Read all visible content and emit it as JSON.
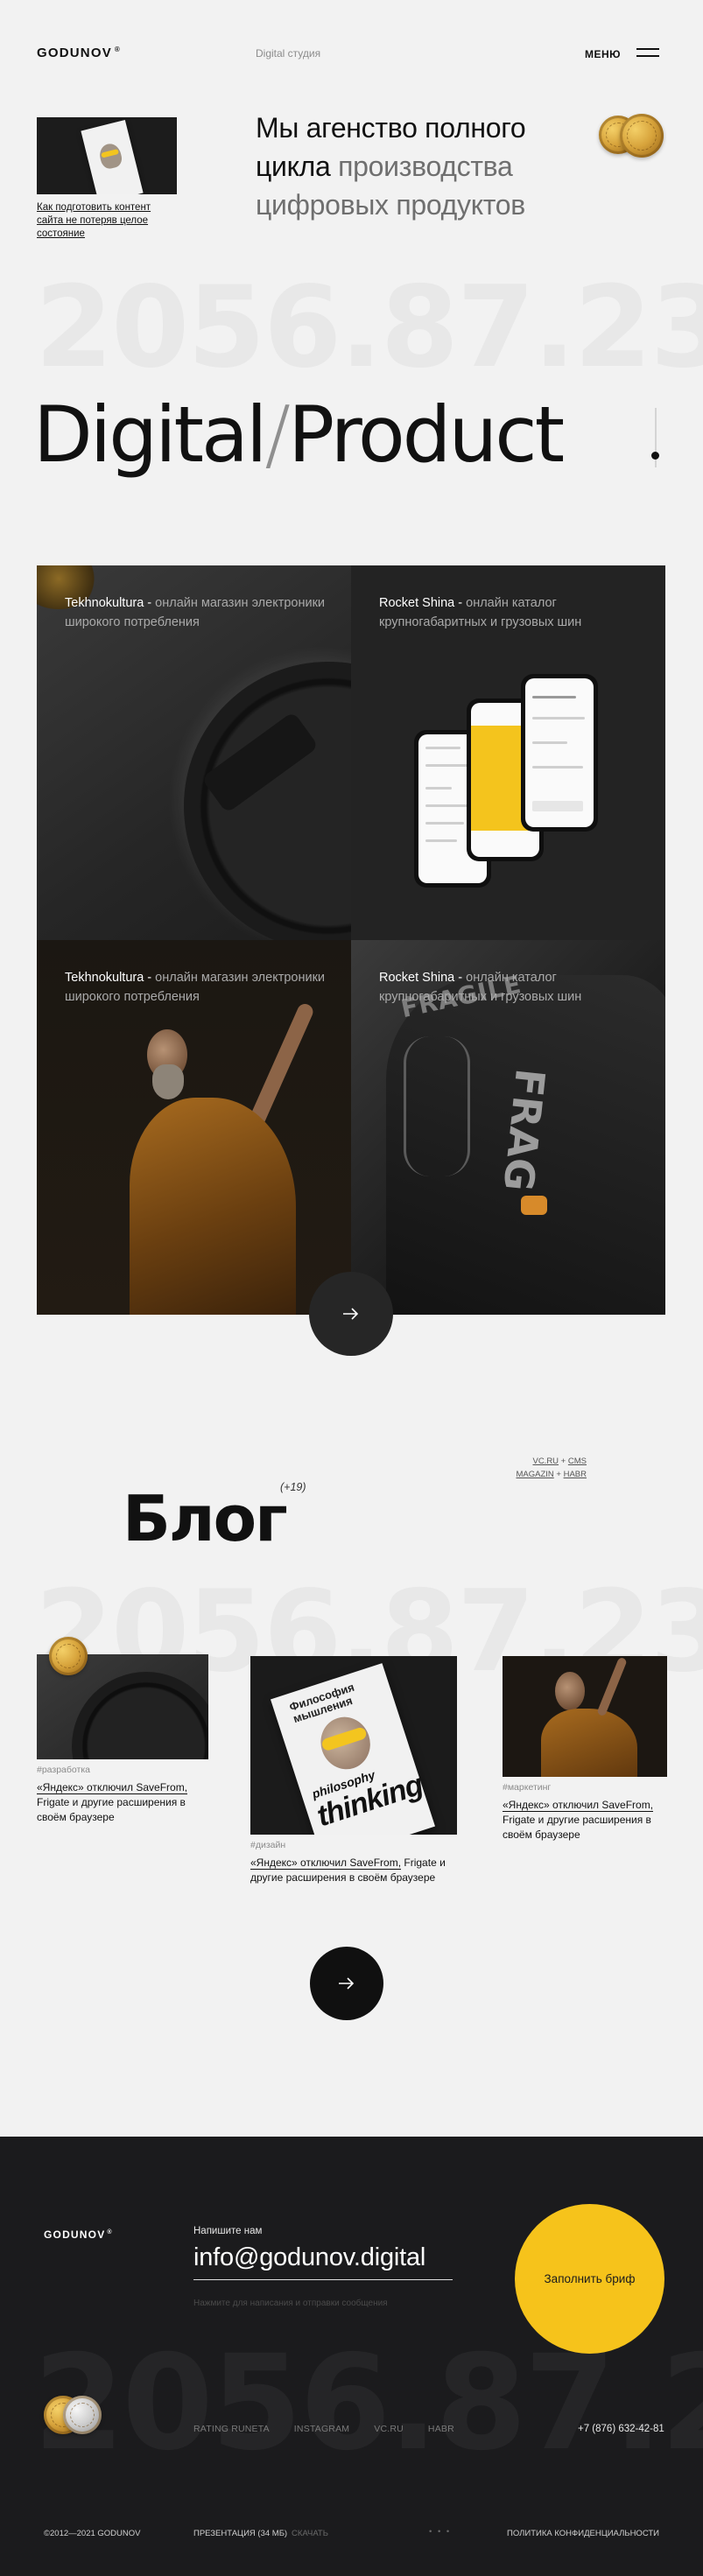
{
  "header": {
    "logo": "GODUNOV",
    "logo_mark": "®",
    "tagline": "Digital студия",
    "menu_label": "МЕНЮ"
  },
  "intro": {
    "card_link": "Как подготовить контент сайта не потеряв целое состояние",
    "headline_dark": "Мы агенство полного цикла",
    "headline_muted": "производства цифровых продуктов"
  },
  "decor_number": "2056.87.23",
  "hero": {
    "word_left": "Digital",
    "slash": "/",
    "word_right": "Product"
  },
  "projects": [
    {
      "name": "Tekhnokultura",
      "desc": "онлайн магазин электроники широкого потребления"
    },
    {
      "name": "Rocket Shina",
      "desc": "онлайн каталог крупногабаритных и грузовых шин"
    },
    {
      "name": "Tekhnokultura",
      "desc": "онлайн магазин электроники широкого потребления"
    },
    {
      "name": "Rocket Shina",
      "desc": "онлайн каталог крупногабаритных и грузовых шин"
    }
  ],
  "project_separator": " - ",
  "blog": {
    "title": "Блог",
    "count": "(+19)",
    "sources": [
      "VC.RU",
      "CMS",
      "MAGAZIN",
      "HABR"
    ],
    "posts": [
      {
        "tag": "#разработка",
        "title_link": "«Яндекс» отключил SaveFrom,",
        "title_rest": "Frigate и другие расширения в своём браузере"
      },
      {
        "tag": "#дизайн",
        "title_link": "«Яндекс» отключил SaveFrom,",
        "title_rest": "Frigate и другие расширения в своём браузере"
      },
      {
        "tag": "#маркетинг",
        "title_link": "«Яндекс» отключил SaveFrom,",
        "title_rest": "Frigate и другие расширения в своём браузере"
      }
    ],
    "magazine": {
      "word1": "Философия",
      "word2": "мышления",
      "word3": "philosophy",
      "word4": "thinking"
    }
  },
  "footer": {
    "logo": "GODUNOV",
    "logo_mark": "®",
    "write_label": "Напишите нам",
    "email": "info@godunov.digital",
    "hint": "Нажмите для написания и отправки сообщения",
    "brief_button": "Заполнить бриф",
    "links": [
      "RATING RUNETA",
      "INSTAGRAM",
      "VC.RU",
      "HABR"
    ],
    "phone": "+7 (876) 632-42-81",
    "copyright": "©2012—2021 GODUNOV",
    "presentation": "ПРЕЗЕНТАЦИЯ (34 МБ)",
    "download": "СКАЧАТЬ",
    "dots": "• • •",
    "privacy": "ПОЛИТИКА КОНФИДЕНЦИАЛЬНОСТИ"
  },
  "colors": {
    "accent_yellow": "#f6c31b",
    "footer_bg": "#1b1b1d",
    "page_bg": "#f2f2f2"
  },
  "icons": [
    "menu-icon",
    "arrow-right-icon",
    "coin-icon"
  ]
}
